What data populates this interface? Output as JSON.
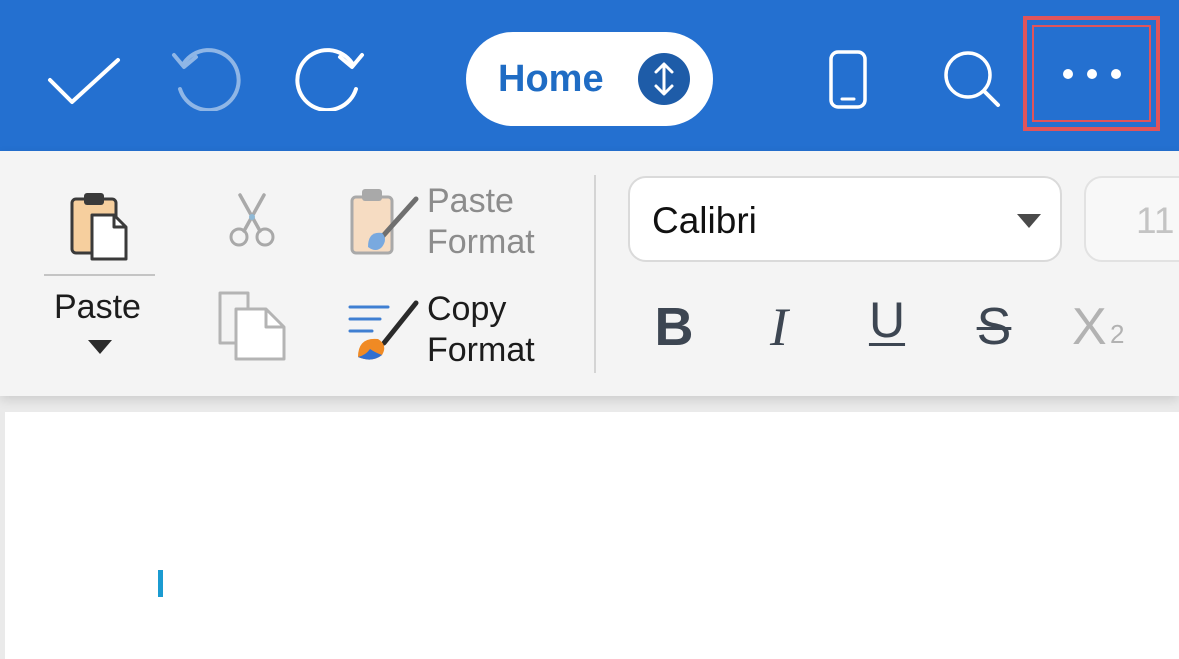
{
  "colors": {
    "topbar_bg": "#2470d0",
    "home_label": "#1f6cc4",
    "highlight_border": "#e0545a",
    "cursor": "#1b9bd1"
  },
  "topbar": {
    "done_icon": "checkmark-icon",
    "undo_icon": "undo-icon",
    "redo_icon": "redo-icon",
    "tab_label": "Home",
    "tab_toggle_icon": "up-down-arrows-icon",
    "mobile_view_icon": "phone-icon",
    "search_icon": "search-icon",
    "more_icon": "ellipsis-icon"
  },
  "ribbon": {
    "paste_label": "Paste",
    "paste_format_line1": "Paste",
    "paste_format_line2": "Format",
    "copy_format_line1": "Copy",
    "copy_format_line2": "Format",
    "font_name": "Calibri",
    "font_size": "11",
    "bold_label": "B",
    "italic_label": "I",
    "underline_label": "U",
    "strike_label": "S",
    "subscript_label": "X",
    "subscript_sub": "2"
  }
}
